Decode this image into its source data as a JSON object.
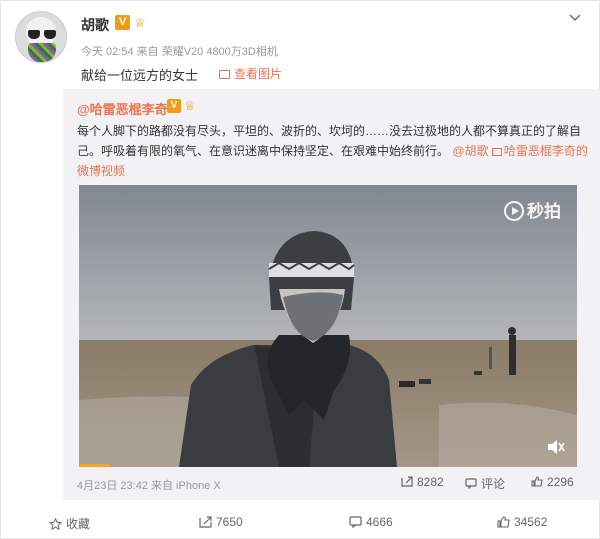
{
  "author": {
    "name": "胡歌",
    "verified_mark": "V",
    "fan_mark": "♕",
    "meta": "今天 02:54 来自 荣耀V20 4800万3D相机"
  },
  "post": {
    "text": "献给一位远方的女士",
    "view_images": "查看图片"
  },
  "repost": {
    "user": "@哈雷恶棍李奇",
    "verified_mark": "V",
    "fan_mark": "♕",
    "text_main": "每个人脚下的路都没有尽头，平坦的、波折的、坎坷的……没去过极地的人都不算真正的了解自己。呼吸着有限的氧气、在意识迷离中保持坚定、在艰难中始终前行。",
    "mention": "@胡歌",
    "video_link": "哈雷恶棍李奇的微博视频",
    "watermark": "秒拍",
    "progress": 0.06,
    "meta": "4月23日 23:42 来自 iPhone X",
    "reposts": "8282",
    "comments_label": "评论",
    "likes": "2296"
  },
  "actions": {
    "favorite": "收藏",
    "reposts": "7650",
    "comments": "4666",
    "likes": "34562"
  },
  "colors": {
    "accent": "#eb7350",
    "badge": "#f39c12",
    "repost_bg": "#f2f2f5",
    "progress": "#f5a623"
  },
  "icons": [
    "chevron-down-icon",
    "image-icon",
    "video-link-icon",
    "play-icon",
    "mute-icon",
    "repost-icon",
    "comment-icon",
    "like-icon",
    "star-icon"
  ]
}
